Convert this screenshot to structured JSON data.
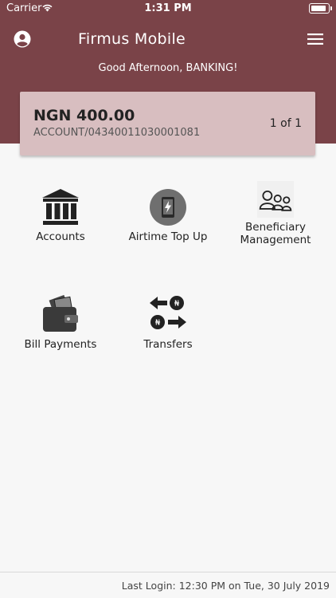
{
  "status_bar": {
    "carrier": "Carrier",
    "time": "1:31 PM"
  },
  "header": {
    "title": "Firmus Mobile",
    "greeting": "Good Afternoon, BANKING!",
    "background": "#7a4348"
  },
  "account_card": {
    "amount": "NGN 400.00",
    "account": "ACCOUNT/04340011030001081",
    "pager": "1 of 1"
  },
  "menu": {
    "accounts": "Accounts",
    "airtime": "Airtime Top Up",
    "beneficiary_line1": "Beneficiary",
    "beneficiary_line2": "Management",
    "bill_payments": "Bill Payments",
    "transfers": "Transfers"
  },
  "footer": {
    "last_login": "Last Login: 12:30 PM on Tue, 30 July 2019"
  },
  "icons": [
    "profile-icon",
    "menu-icon",
    "bank-icon",
    "phone-topup-icon",
    "group-icon",
    "wallet-icon",
    "transfer-arrows-icon"
  ]
}
